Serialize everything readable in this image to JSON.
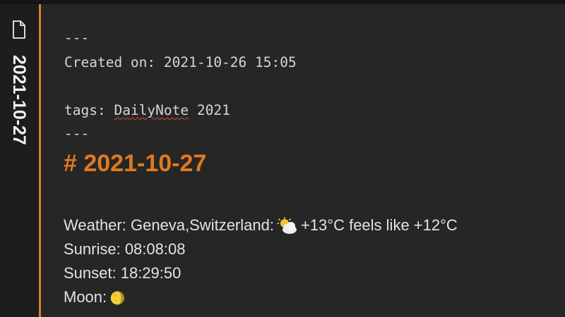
{
  "sidebar": {
    "tab_title": "2021-10-27",
    "file_icon": "file-icon"
  },
  "frontmatter": {
    "open_delim": "---",
    "created_label": "Created on: 2021-10-26 15:05",
    "tags_prefix": "tags: ",
    "tag_1": "DailyNote",
    "tag_2": " 2021",
    "close_delim": "---"
  },
  "note": {
    "heading": "# 2021-10-27",
    "weather_prefix": "Weather: Geneva,Switzerland:",
    "weather_icon": "sun-behind-cloud-icon",
    "weather_suffix": "+13°C feels like +12°C",
    "sunrise": "Sunrise: 08:08:08",
    "sunset": "Sunset: 18:29:50",
    "moon_prefix": "Moon:",
    "moon_icon": "moon-phase-icon"
  },
  "colors": {
    "accent": "#d9822b",
    "heading": "#e07a1e",
    "background": "#262626"
  }
}
